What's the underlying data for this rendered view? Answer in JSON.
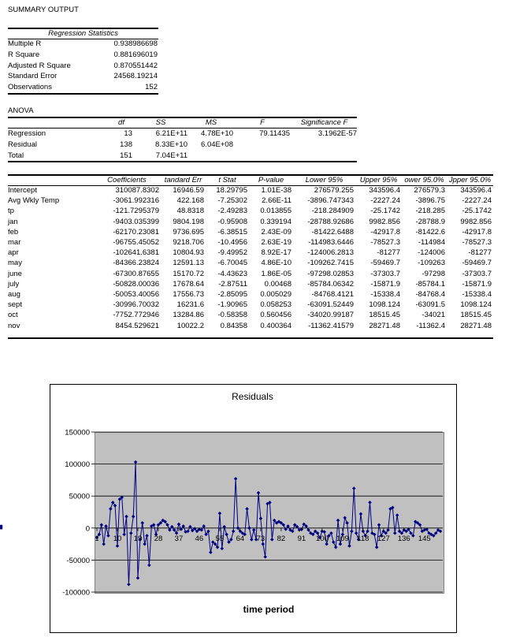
{
  "summary_title": "SUMMARY OUTPUT",
  "regression_statistics": {
    "header": "Regression Statistics",
    "rows": [
      {
        "label": "Multiple R",
        "value": "0.938986698"
      },
      {
        "label": "R Square",
        "value": "0.881696019"
      },
      {
        "label": "Adjusted R Square",
        "value": "0.870551442"
      },
      {
        "label": "Standard Error",
        "value": "24568.19214"
      },
      {
        "label": "Observations",
        "value": "152"
      }
    ]
  },
  "anova": {
    "title": "ANOVA",
    "headers": [
      "df",
      "SS",
      "MS",
      "F",
      "Significance F"
    ],
    "rows": [
      {
        "label": "Regression",
        "df": "13",
        "ss": "6.21E+11",
        "ms": "4.78E+10",
        "f": "79.11435",
        "sig": "3.1962E-57"
      },
      {
        "label": "Residual",
        "df": "138",
        "ss": "8.33E+10",
        "ms": "6.04E+08",
        "f": "",
        "sig": ""
      },
      {
        "label": "Total",
        "df": "151",
        "ss": "7.04E+11",
        "ms": "",
        "f": "",
        "sig": ""
      }
    ]
  },
  "coefficients": {
    "headers": [
      "Coefficients",
      "tandard Err",
      "t Stat",
      "P-value",
      "Lower 95%",
      "Upper 95%",
      "ower 95.0%",
      "Jpper 95.0%"
    ],
    "rows": [
      {
        "label": "Intercept",
        "v": [
          "310087.8302",
          "16946.59",
          "18.29795",
          "1.01E-38",
          "276579.255",
          "343596.4",
          "276579.3",
          "343596.4"
        ]
      },
      {
        "label": "Avg Wkly Temp",
        "v": [
          "-3061.992316",
          "422.168",
          "-7.25302",
          "2.66E-11",
          "-3896.747343",
          "-2227.24",
          "-3896.75",
          "-2227.24"
        ]
      },
      {
        "label": "tp",
        "v": [
          "-121.7295379",
          "48.8318",
          "-2.49283",
          "0.013855",
          "-218.284909",
          "-25.1742",
          "-218.285",
          "-25.1742"
        ]
      },
      {
        "label": "jan",
        "v": [
          "-9403.035399",
          "9804.198",
          "-0.95908",
          "0.339194",
          "-28788.92686",
          "9982.856",
          "-28788.9",
          "9982.856"
        ]
      },
      {
        "label": "feb",
        "v": [
          "-62170.23081",
          "9736.695",
          "-6.38515",
          "2.43E-09",
          "-81422.6488",
          "-42917.8",
          "-81422.6",
          "-42917.8"
        ]
      },
      {
        "label": "mar",
        "v": [
          "-96755.45052",
          "9218.706",
          "-10.4956",
          "2.63E-19",
          "-114983.6446",
          "-78527.3",
          "-114984",
          "-78527.3"
        ]
      },
      {
        "label": "apr",
        "v": [
          "-102641.6381",
          "10804.93",
          "-9.49952",
          "8.92E-17",
          "-124006.2813",
          "-81277",
          "-124006",
          "-81277"
        ]
      },
      {
        "label": "may",
        "v": [
          "-84366.23824",
          "12591.13",
          "-6.70045",
          "4.86E-10",
          "-109262.7415",
          "-59469.7",
          "-109263",
          "-59469.7"
        ]
      },
      {
        "label": "june",
        "v": [
          "-67300.87655",
          "15170.72",
          "-4.43623",
          "1.86E-05",
          "-97298.02853",
          "-37303.7",
          "-97298",
          "-37303.7"
        ]
      },
      {
        "label": "july",
        "v": [
          "-50828.00036",
          "17678.64",
          "-2.87511",
          "0.00468",
          "-85784.06342",
          "-15871.9",
          "-85784.1",
          "-15871.9"
        ]
      },
      {
        "label": "aug",
        "v": [
          "-50053.40056",
          "17556.73",
          "-2.85095",
          "0.005029",
          "-84768.4121",
          "-15338.4",
          "-84768.4",
          "-15338.4"
        ]
      },
      {
        "label": "sept",
        "v": [
          "-30996.70032",
          "16231.6",
          "-1.90965",
          "0.058253",
          "-63091.52449",
          "1098.124",
          "-63091.5",
          "1098.124"
        ]
      },
      {
        "label": "oct",
        "v": [
          "-7752.772946",
          "13284.86",
          "-0.58358",
          "0.560456",
          "-34020.99187",
          "18515.45",
          "-34021",
          "18515.45"
        ]
      },
      {
        "label": "nov",
        "v": [
          "8454.529621",
          "10022.2",
          "0.84358",
          "0.400364",
          "-11362.41579",
          "28271.48",
          "-11362.4",
          "28271.48"
        ]
      }
    ]
  },
  "chart_data": {
    "type": "line",
    "title": "Residuals",
    "xlabel": "time period",
    "ylabel": "",
    "ylim": [
      -100000,
      150000
    ],
    "yticks": [
      150000,
      100000,
      50000,
      0,
      -50000,
      -100000
    ],
    "ytick_labels": [
      "150000",
      "100000",
      "50000",
      "0",
      "-50000",
      "-100000"
    ],
    "xticks": [
      1,
      10,
      19,
      28,
      37,
      46,
      55,
      64,
      73,
      82,
      91,
      100,
      109,
      118,
      127,
      136,
      145
    ],
    "xtick_labels": [
      "1",
      "10",
      "19",
      "28",
      "37",
      "46",
      "55",
      "64",
      "73",
      "82",
      "91",
      "100",
      "109",
      "118",
      "127",
      "136",
      "145"
    ],
    "grid": true,
    "legend": "none",
    "color": "#000080",
    "x": [
      1,
      2,
      3,
      4,
      5,
      6,
      7,
      8,
      9,
      10,
      11,
      12,
      13,
      14,
      15,
      16,
      17,
      18,
      19,
      20,
      21,
      22,
      23,
      24,
      25,
      26,
      27,
      28,
      29,
      30,
      31,
      32,
      33,
      34,
      35,
      36,
      37,
      38,
      39,
      40,
      41,
      42,
      43,
      44,
      45,
      46,
      47,
      48,
      49,
      50,
      51,
      52,
      53,
      54,
      55,
      56,
      57,
      58,
      59,
      60,
      61,
      62,
      63,
      64,
      65,
      66,
      67,
      68,
      69,
      70,
      71,
      72,
      73,
      74,
      75,
      76,
      77,
      78,
      79,
      80,
      81,
      82,
      83,
      84,
      85,
      86,
      87,
      88,
      89,
      90,
      91,
      92,
      93,
      94,
      95,
      96,
      97,
      98,
      99,
      100,
      101,
      102,
      103,
      104,
      105,
      106,
      107,
      108,
      109,
      110,
      111,
      112,
      113,
      114,
      115,
      116,
      117,
      118,
      119,
      120,
      121,
      122,
      123,
      124,
      125,
      126,
      127,
      128,
      129,
      130,
      131,
      132,
      133,
      134,
      135,
      136,
      137,
      138,
      139,
      140,
      141,
      142,
      143,
      144,
      145,
      146,
      147,
      148,
      149,
      150,
      151,
      152
    ],
    "values": [
      -15000,
      -10000,
      5000,
      -25000,
      3000,
      -12000,
      30000,
      40000,
      35000,
      -28000,
      45000,
      48000,
      -10000,
      18000,
      -88000,
      -8000,
      18000,
      103000,
      -78000,
      -18000,
      8000,
      -25000,
      -12000,
      -58000,
      3000,
      5000,
      -10000,
      5000,
      8000,
      12000,
      10000,
      5000,
      -3000,
      2000,
      -3000,
      -8000,
      6000,
      -2000,
      3000,
      -6000,
      -5000,
      2000,
      -4000,
      -1000,
      -5000,
      -2000,
      -3000,
      3000,
      -10000,
      -5000,
      -38000,
      -22000,
      -25000,
      -30000,
      23000,
      -32000,
      2000,
      -10000,
      -22000,
      -18000,
      -5000,
      77000,
      0,
      -5000,
      -8000,
      -10000,
      30000,
      0,
      -18000,
      -3000,
      -18000,
      55000,
      15000,
      -25000,
      -45000,
      38000,
      40000,
      -18000,
      12000,
      8000,
      10000,
      8000,
      5000,
      -2000,
      3000,
      -3000,
      -5000,
      5000,
      2000,
      -3000,
      -2000,
      6000,
      3000,
      -3000,
      -8000,
      -10000,
      -5000,
      -8000,
      -15000,
      -5000,
      -6000,
      -25000,
      -12000,
      -8000,
      -22000,
      -30000,
      12000,
      -25000,
      -10000,
      16000,
      8000,
      -28000,
      -5000,
      62000,
      -8000,
      -18000,
      22000,
      -5000,
      -12000,
      -5000,
      40000,
      -8000,
      -10000,
      -30000,
      5000,
      -12000,
      -5000,
      -8000,
      -3000,
      30000,
      32000,
      -8000,
      20000,
      -5000,
      -8000,
      -3000,
      -5000,
      -2000,
      -8000,
      -12000,
      10000,
      8000,
      5000,
      -5000,
      -3000,
      -2000,
      -8000,
      -10000,
      -12000,
      -8000,
      -3000,
      -5000,
      0,
      3000
    ]
  }
}
